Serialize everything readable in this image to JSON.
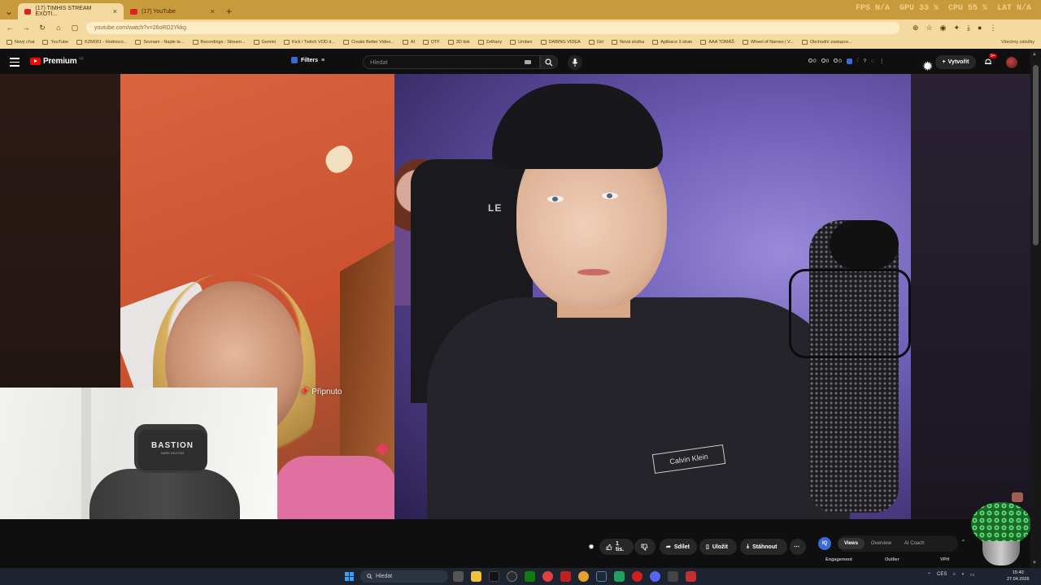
{
  "browser": {
    "tabs": [
      {
        "label": "(17) TIMHIS STREAM EXOTI..."
      },
      {
        "label": "(17) YouTube"
      }
    ],
    "perf": {
      "fps": "FPS N/A",
      "gpu": "GPU 33 %",
      "cpu": "CPU 55 %",
      "lat": "LAT N/A"
    },
    "url": "youtube.com/watch?v=26oRD2Ykkg",
    "bookmarks": [
      "Nový chat",
      "YouTube",
      "KZM001 - Hodnoco...",
      "Seznam - Najde te...",
      "Recordings - Stream...",
      "Gemini",
      "Kick / Twitch VOD d...",
      "Create Better Video...",
      "AI",
      "DTF",
      "3D tisk",
      "Zelňany",
      "Umbev",
      "DABING VIDEA",
      "Girl",
      "Nová složka",
      "Aplikace 3 stran",
      "AAA TOMÁŠ",
      "Wheel of Names | V...",
      "Obchodní zastupce..."
    ],
    "bookmarks_right": "Všechny záložky"
  },
  "youtube": {
    "brand": "Premium",
    "brand_sup": "CZ",
    "filters_label": "Filters",
    "search_placeholder": "Hledat",
    "ext_counts": [
      "0",
      "0",
      "0"
    ],
    "create_label": "Vytvořit",
    "notif_badge": "9+"
  },
  "video": {
    "pinned_label": "Připnuto",
    "chair_logo": "LE",
    "shirt_brand": "Calvin Klein",
    "webcam_chair_text": "BASTION",
    "webcam_chair_sub": "DARK EDITION"
  },
  "actions": {
    "likes": "1 tis.",
    "share": "Sdílet",
    "save": "Uložit",
    "download": "Stáhnout",
    "more": "⋯"
  },
  "ext_panel": {
    "badge": "IQ",
    "tabs": [
      "Views",
      "Overview",
      "AI Coach"
    ],
    "selected_tab": "Views",
    "labels": [
      "Engagement",
      "Outlier",
      "VPH"
    ]
  },
  "taskbar": {
    "search_placeholder": "Hledat",
    "lang": "CES",
    "time": "15:40",
    "date": "27.04.2026"
  },
  "colors": {
    "brand_red": "#ff0000",
    "browser_frame": "#c79a3c",
    "accent_blue": "#3a6ad8"
  }
}
